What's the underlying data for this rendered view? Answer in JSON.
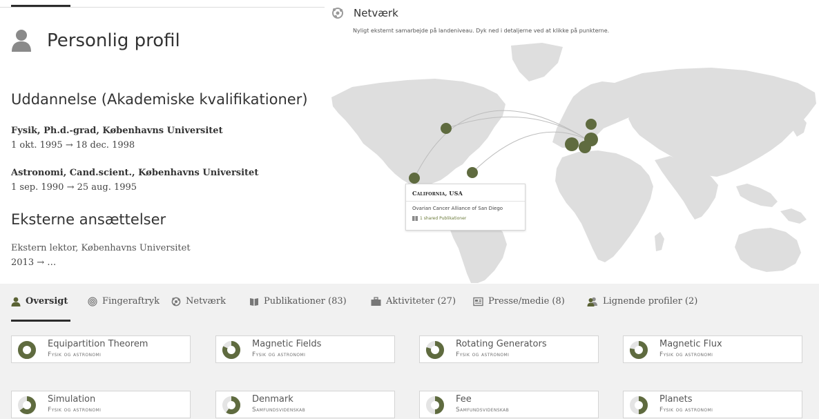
{
  "profile": {
    "title": "Personlig profil"
  },
  "education": {
    "heading": "Uddannelse (Akademiske kvalifikationer)",
    "items": [
      {
        "name": "Fysik, Ph.d.-grad, Københavns Universitet",
        "date": "1 okt. 1995 → 18 dec. 1998"
      },
      {
        "name": "Astronomi, Cand.scient., Københavns Universitet",
        "date": "1 sep. 1990 → 25 aug. 1995"
      }
    ]
  },
  "external": {
    "heading": "Eksterne ansættelser",
    "items": [
      {
        "role": "Ekstern lektor, Københavns Universitet",
        "date": "2013 → …"
      }
    ]
  },
  "network": {
    "title": "Netværk",
    "subtitle": "Nyligt eksternt samarbejde på landeniveau. Dyk ned i detaljerne ved at klikke på punkterne.",
    "tooltip": {
      "location": "California, USA",
      "organization": "Ovarian Cancer Alliance of San Diego",
      "shared": "1 shared Publikationer"
    }
  },
  "tabs": [
    {
      "label": "Oversigt",
      "icon": "person-icon"
    },
    {
      "label": "Fingeraftryk",
      "icon": "fingerprint-icon"
    },
    {
      "label": "Netværk",
      "icon": "globe-icon"
    },
    {
      "label": "Publikationer (83)",
      "icon": "book-icon"
    },
    {
      "label": "Aktiviteter (27)",
      "icon": "briefcase-icon"
    },
    {
      "label": "Presse/medie (8)",
      "icon": "newspaper-icon"
    },
    {
      "label": "Lignende profiler (2)",
      "icon": "people-icon"
    }
  ],
  "concepts": [
    {
      "name": "Equipartition Theorem",
      "category": "Fysik og astronomi",
      "weight": 1.0
    },
    {
      "name": "Magnetic Fields",
      "category": "Fysik og astronomi",
      "weight": 0.82
    },
    {
      "name": "Rotating Generators",
      "category": "Fysik og astronomi",
      "weight": 0.8
    },
    {
      "name": "Magnetic Flux",
      "category": "Fysik og astronomi",
      "weight": 0.78
    },
    {
      "name": "Simulation",
      "category": "Fysik og astronomi",
      "weight": 0.65
    },
    {
      "name": "Denmark",
      "category": "Samfundsvidenskab",
      "weight": 0.6
    },
    {
      "name": "Fee",
      "category": "Samfundsvidenskab",
      "weight": 0.5
    },
    {
      "name": "Planets",
      "category": "Fysik og astronomi",
      "weight": 0.5
    }
  ],
  "colors": {
    "accent": "#5f6b3f",
    "land": "#dedede",
    "panel_bg": "#f1f1f1"
  }
}
